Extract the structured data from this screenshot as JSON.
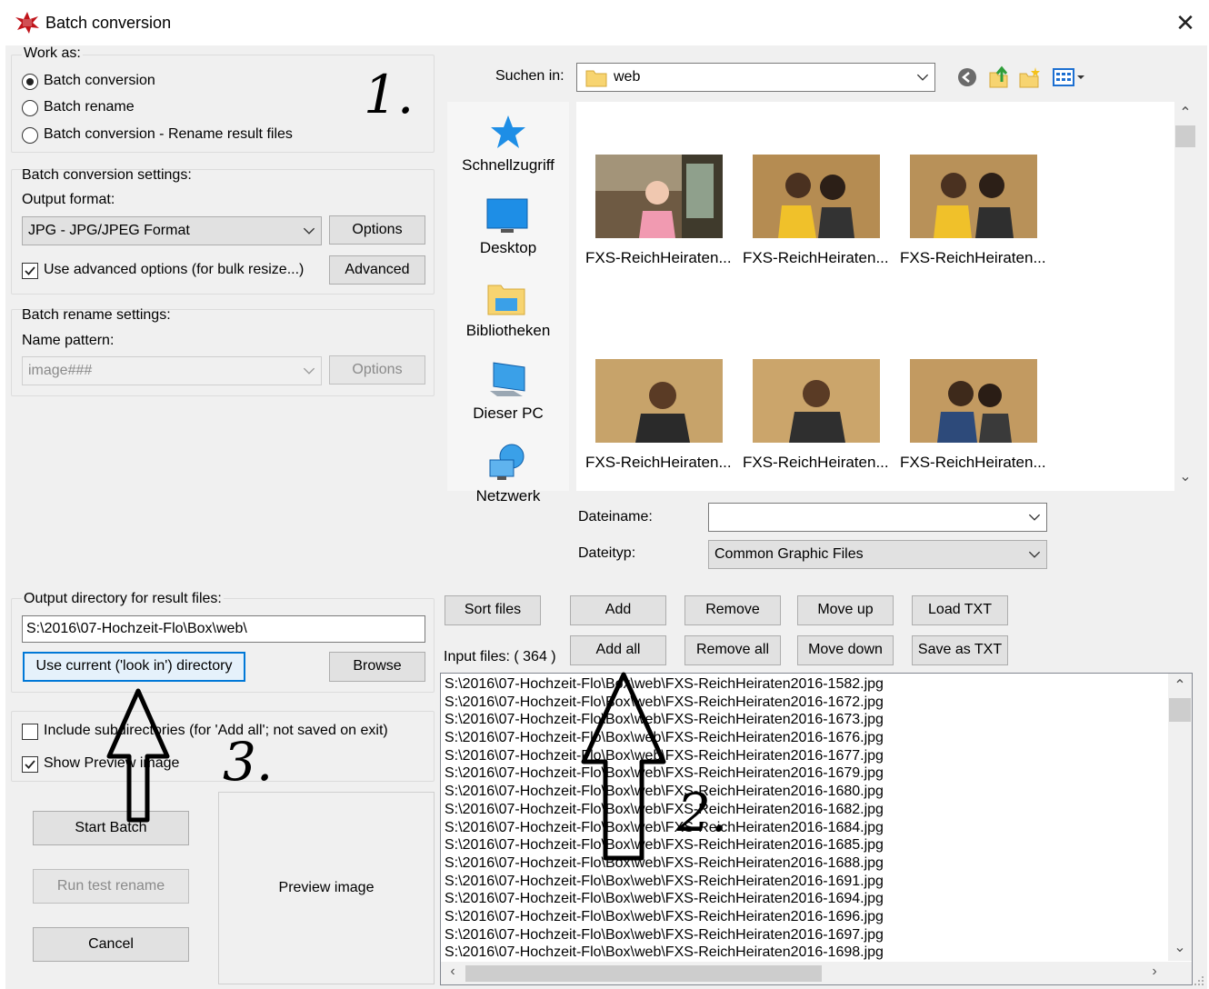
{
  "window": {
    "title": "Batch conversion",
    "close_label": "✕"
  },
  "work_as": {
    "label": "Work as:",
    "options": [
      {
        "label": "Batch conversion",
        "selected": true
      },
      {
        "label": "Batch rename",
        "selected": false
      },
      {
        "label": "Batch conversion - Rename result files",
        "selected": false
      }
    ]
  },
  "conversion_settings": {
    "label": "Batch conversion settings:",
    "format_label": "Output format:",
    "format_value": "JPG - JPG/JPEG Format",
    "options_button": "Options",
    "advanced_checkbox": "Use advanced options (for bulk resize...)",
    "advanced_checked": true,
    "advanced_button": "Advanced"
  },
  "rename_settings": {
    "label": "Batch rename settings:",
    "pattern_label": "Name pattern:",
    "pattern_value": "image###",
    "options_button": "Options"
  },
  "output": {
    "label": "Output directory for result files:",
    "path": "S:\\2016\\07-Hochzeit-Flo\\Box\\web\\",
    "use_current_button": "Use current ('look in') directory",
    "browse_button": "Browse"
  },
  "extra_options": {
    "include_subdirs": "Include subdirectories (for 'Add all'; not saved on exit)",
    "include_subdirs_checked": false,
    "show_preview": "Show Preview image",
    "show_preview_checked": true
  },
  "actions": {
    "start": "Start Batch",
    "test_rename": "Run test rename",
    "cancel": "Cancel"
  },
  "preview": {
    "label": "Preview image"
  },
  "file_browser": {
    "look_in_label": "Suchen in:",
    "look_in_value": "web",
    "places": [
      "Schnellzugriff",
      "Desktop",
      "Bibliotheken",
      "Dieser PC",
      "Netzwerk"
    ],
    "thumbnails": [
      "FXS-ReichHeiraten...",
      "FXS-ReichHeiraten...",
      "FXS-ReichHeiraten...",
      "FXS-ReichHeiraten...",
      "FXS-ReichHeiraten...",
      "FXS-ReichHeiraten..."
    ],
    "filename_label": "Dateiname:",
    "filename_value": "",
    "filetype_label": "Dateityp:",
    "filetype_value": "Common Graphic Files"
  },
  "file_buttons": {
    "sort": "Sort files",
    "add": "Add",
    "remove": "Remove",
    "move_up": "Move up",
    "load_txt": "Load TXT",
    "add_all": "Add all",
    "remove_all": "Remove all",
    "move_down": "Move down",
    "save_txt": "Save as TXT"
  },
  "input_files": {
    "label": "Input files: ( 364 )",
    "files": [
      "S:\\2016\\07-Hochzeit-Flo\\Box\\web\\FXS-ReichHeiraten2016-1582.jpg",
      "S:\\2016\\07-Hochzeit-Flo\\Box\\web\\FXS-ReichHeiraten2016-1672.jpg",
      "S:\\2016\\07-Hochzeit-Flo\\Box\\web\\FXS-ReichHeiraten2016-1673.jpg",
      "S:\\2016\\07-Hochzeit-Flo\\Box\\web\\FXS-ReichHeiraten2016-1676.jpg",
      "S:\\2016\\07-Hochzeit-Flo\\Box\\web\\FXS-ReichHeiraten2016-1677.jpg",
      "S:\\2016\\07-Hochzeit-Flo\\Box\\web\\FXS-ReichHeiraten2016-1679.jpg",
      "S:\\2016\\07-Hochzeit-Flo\\Box\\web\\FXS-ReichHeiraten2016-1680.jpg",
      "S:\\2016\\07-Hochzeit-Flo\\Box\\web\\FXS-ReichHeiraten2016-1682.jpg",
      "S:\\2016\\07-Hochzeit-Flo\\Box\\web\\FXS-ReichHeiraten2016-1684.jpg",
      "S:\\2016\\07-Hochzeit-Flo\\Box\\web\\FXS-ReichHeiraten2016-1685.jpg",
      "S:\\2016\\07-Hochzeit-Flo\\Box\\web\\FXS-ReichHeiraten2016-1688.jpg",
      "S:\\2016\\07-Hochzeit-Flo\\Box\\web\\FXS-ReichHeiraten2016-1691.jpg",
      "S:\\2016\\07-Hochzeit-Flo\\Box\\web\\FXS-ReichHeiraten2016-1694.jpg",
      "S:\\2016\\07-Hochzeit-Flo\\Box\\web\\FXS-ReichHeiraten2016-1696.jpg",
      "S:\\2016\\07-Hochzeit-Flo\\Box\\web\\FXS-ReichHeiraten2016-1697.jpg",
      "S:\\2016\\07-Hochzeit-Flo\\Box\\web\\FXS-ReichHeiraten2016-1698.jpg"
    ]
  },
  "annotations": {
    "step1": "1.",
    "step2": "2.",
    "step3": "3."
  }
}
